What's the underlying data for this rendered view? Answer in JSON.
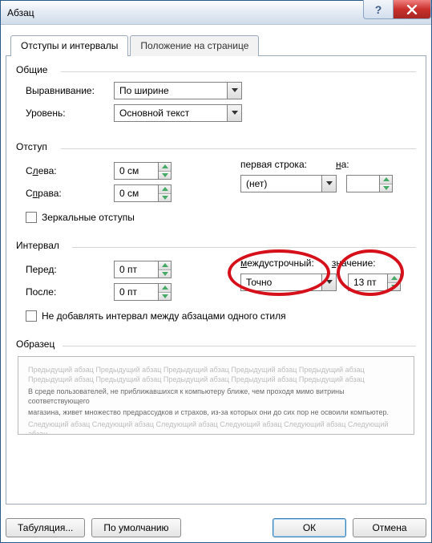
{
  "window": {
    "title": "Абзац"
  },
  "tabs": {
    "active": "Отступы и интервалы",
    "inactive": "Положение на странице"
  },
  "groups": {
    "general": {
      "label": "Общие",
      "alignment_label": "Выравнивание:",
      "alignment_value": "По ширине",
      "level_label": "Уровень:",
      "level_value": "Основной текст"
    },
    "indent": {
      "label": "Отступ",
      "left_label_pre": "С",
      "left_label_u": "л",
      "left_label_post": "ева:",
      "left_value": "0 см",
      "right_label_pre": "С",
      "right_label_u": "п",
      "right_label_post": "рава:",
      "right_value": "0 см",
      "firstline_label": "первая строка:",
      "on_label_u": "н",
      "on_label_post": "а:",
      "firstline_value": "(нет)",
      "on_value": "",
      "mirror_label": "Зеркальные отступы"
    },
    "spacing": {
      "label": "Интервал",
      "before_label": "Перед:",
      "before_value": "0 пт",
      "after_label": "После:",
      "after_value": "0 пт",
      "linespacing_label_u": "м",
      "linespacing_label": "еждустрочный:",
      "value_label_u": "з",
      "value_label": "начение:",
      "linespacing_value": "Точно",
      "value_value": "13 пт",
      "nospace_label": "Не добавлять интервал между абзацами одного стиля"
    },
    "preview": {
      "label": "Образец",
      "faint1": "Предыдущий абзац Предыдущий абзац Предыдущий абзац Предыдущий абзац Предыдущий абзац",
      "faint2": "Предыдущий абзац Предыдущий абзац Предыдущий абзац Предыдущий абзац Предыдущий абзац",
      "dark1": "В среде пользователей, не приближавшихся к компьютеру ближе, чем проходя мимо витрины соответствующего",
      "dark2": "магазина, живет множество предрассудков и страхов, из-за которых они до сих пор не освоили компьютер.",
      "faint3": "Следующий абзац Следующий абзац Следующий абзац Следующий абзац Следующий абзац Следующий абзац",
      "faint4": "Следующий абзац Следующий абзац Следующий абзац Следующий абзац Следующий абзац Следующий абзац"
    }
  },
  "footer": {
    "tabs_btn": "Табуляция...",
    "default_btn": "По умолчанию",
    "ok_btn": "ОК",
    "cancel_btn": "Отмена"
  }
}
